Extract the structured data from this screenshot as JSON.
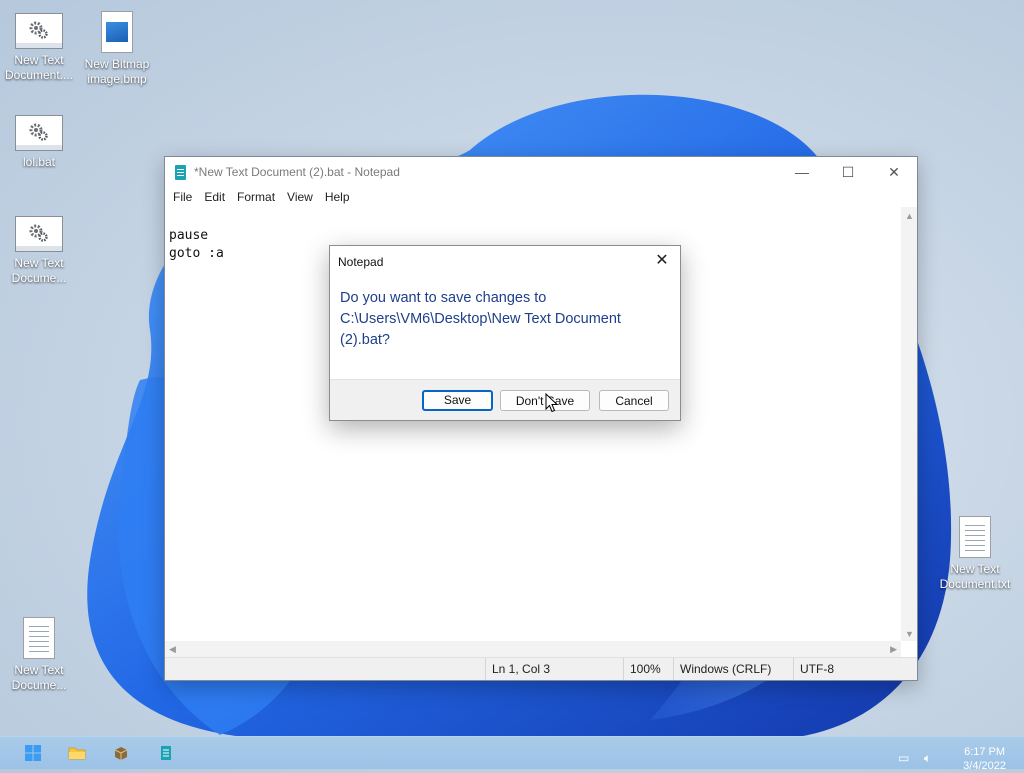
{
  "desktop": {
    "icons": [
      {
        "label": "New Text\nDocument....",
        "type": "bat"
      },
      {
        "label": "New Bitmap\nimage.bmp",
        "type": "bmp"
      },
      {
        "label": "lol.bat",
        "type": "bat"
      },
      {
        "label": "New Text\nDocume...",
        "type": "bat"
      },
      {
        "label": "New Text\nDocume...",
        "type": "txt"
      },
      {
        "label": "New Text\nDocument.txt",
        "type": "txt"
      }
    ]
  },
  "notepad": {
    "title": "*New Text Document (2).bat - Notepad",
    "window_controls": {
      "minimize": "—",
      "maximize": "☐",
      "close": "✕"
    },
    "menu": [
      "File",
      "Edit",
      "Format",
      "View",
      "Help"
    ],
    "content": "pause\ngoto :a",
    "status": {
      "position": "Ln 1, Col 3",
      "zoom": "100%",
      "line_endings": "Windows (CRLF)",
      "encoding": "UTF-8"
    }
  },
  "dialog": {
    "title": "Notepad",
    "message": "Do you want to save changes to C:\\Users\\VM6\\Desktop\\New Text Document (2).bat?",
    "buttons": {
      "save": "Save",
      "dont_save": "Don't Save",
      "cancel": "Cancel"
    }
  },
  "taskbar": {
    "time": "6:17 PM",
    "date": "3/4/2022"
  },
  "colors": {
    "accent": "#0a64c8",
    "dialog_text": "#1e3f8a",
    "taskbar": "#9cc2e5"
  }
}
